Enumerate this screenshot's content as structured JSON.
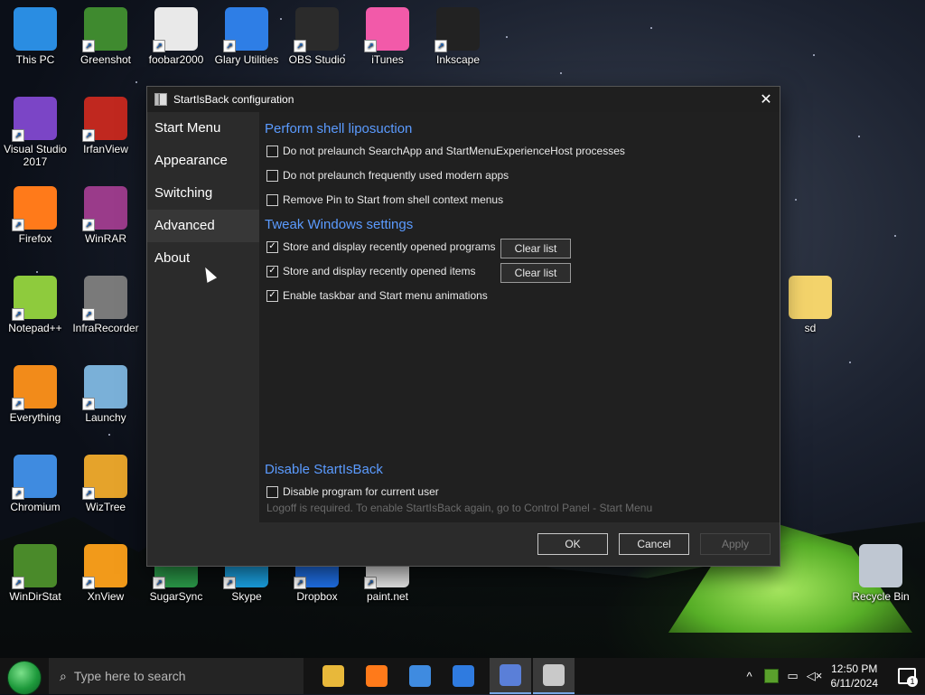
{
  "desktop": {
    "icons": [
      {
        "label": "This PC",
        "icon": "computer-icon",
        "color": "#2a8de2"
      },
      {
        "label": "Greenshot",
        "icon": "greenshot-icon",
        "color": "#3f8a2f"
      },
      {
        "label": "foobar2000",
        "icon": "foobar-icon",
        "color": "#e9e9e9"
      },
      {
        "label": "Glary Utilities",
        "icon": "glary-icon",
        "color": "#2e7ee6"
      },
      {
        "label": "OBS Studio",
        "icon": "obs-icon",
        "color": "#2b2b2b"
      },
      {
        "label": "iTunes",
        "icon": "itunes-icon",
        "color": "#f25aa9"
      },
      {
        "label": "Inkscape",
        "icon": "inkscape-icon",
        "color": "#222222"
      },
      {
        "label": "Visual Studio 2017",
        "icon": "visual-studio-icon",
        "color": "#7b45c6"
      },
      {
        "label": "IrfanView",
        "icon": "irfanview-icon",
        "color": "#c0281f"
      },
      {
        "label": "Firefox",
        "icon": "firefox-icon",
        "color": "#ff7a1a"
      },
      {
        "label": "WinRAR",
        "icon": "winrar-icon",
        "color": "#9a3b8a"
      },
      {
        "label": "Notepad++",
        "icon": "notepad-plus-plus-icon",
        "color": "#8ecb3d"
      },
      {
        "label": "InfraRecorder",
        "icon": "infrarecorder-icon",
        "color": "#7a7a7a"
      },
      {
        "label": "Everything",
        "icon": "everything-icon",
        "color": "#f28b1a"
      },
      {
        "label": "Launchy",
        "icon": "launchy-icon",
        "color": "#7ab0d8"
      },
      {
        "label": "Chromium",
        "icon": "chromium-icon",
        "color": "#3f8be0"
      },
      {
        "label": "WizTree",
        "icon": "wiztree-icon",
        "color": "#e5a32b"
      },
      {
        "label": "WinDirStat",
        "icon": "windirstat-icon",
        "color": "#4a8a2a"
      },
      {
        "label": "XnView",
        "icon": "xnview-icon",
        "color": "#f29a1a"
      },
      {
        "label": "SugarSync",
        "icon": "sugarsync-icon",
        "color": "#2b9a49"
      },
      {
        "label": "Skype",
        "icon": "skype-icon",
        "color": "#1aa0e0"
      },
      {
        "label": "Dropbox",
        "icon": "dropbox-icon",
        "color": "#1f6fe5"
      },
      {
        "label": "paint.net",
        "icon": "paint-net-icon",
        "color": "#e3e3e3"
      },
      {
        "label": "sd",
        "icon": "folder-icon",
        "color": "#f3d36b"
      },
      {
        "label": "Recycle Bin",
        "icon": "recycle-bin-icon",
        "color": "#bfc7d2"
      }
    ]
  },
  "dialog": {
    "title": "StartIsBack configuration",
    "close_glyph": "✕",
    "nav": [
      {
        "label": "Start Menu",
        "active": false
      },
      {
        "label": "Appearance",
        "active": false
      },
      {
        "label": "Switching",
        "active": false
      },
      {
        "label": "Advanced",
        "active": true
      },
      {
        "label": "About",
        "active": false
      }
    ],
    "sections": {
      "shell": {
        "title": "Perform shell liposuction",
        "options": [
          {
            "label": "Do not prelaunch SearchApp and StartMenuExperienceHost processes",
            "checked": false
          },
          {
            "label": "Do not prelaunch frequently used modern apps",
            "checked": false
          },
          {
            "label": "Remove Pin to Start from shell context menus",
            "checked": false
          }
        ]
      },
      "tweak": {
        "title": "Tweak Windows settings",
        "options": [
          {
            "label": "Store and display recently opened programs",
            "checked": true,
            "button": "Clear list"
          },
          {
            "label": "Store and display recently opened items",
            "checked": true,
            "button": "Clear list"
          },
          {
            "label": "Enable taskbar and Start menu animations",
            "checked": true
          }
        ]
      },
      "disable": {
        "title": "Disable StartIsBack",
        "options": [
          {
            "label": "Disable program for current user",
            "checked": false
          }
        ],
        "hint": "Logoff is required. To enable StartIsBack again, go to Control Panel - Start Menu"
      }
    },
    "footer": {
      "ok": "OK",
      "cancel": "Cancel",
      "apply": "Apply"
    }
  },
  "taskbar": {
    "search_placeholder": "Type here to search",
    "apps": [
      {
        "name": "file-explorer",
        "color": "#e8b83a",
        "active": false
      },
      {
        "name": "firefox",
        "color": "#ff7a1a",
        "active": false
      },
      {
        "name": "chromium",
        "color": "#3f8be0",
        "active": false
      },
      {
        "name": "unknown-blue-app",
        "color": "#2f7be0",
        "active": false
      },
      {
        "name": "startisback",
        "color": "#5a7fd8",
        "active": true
      },
      {
        "name": "startisback-config",
        "color": "#c9c9c9",
        "active": true
      }
    ],
    "tray": {
      "chevron": "^",
      "time": "12:50 PM",
      "date": "6/11/2024",
      "notifications": "1"
    }
  }
}
